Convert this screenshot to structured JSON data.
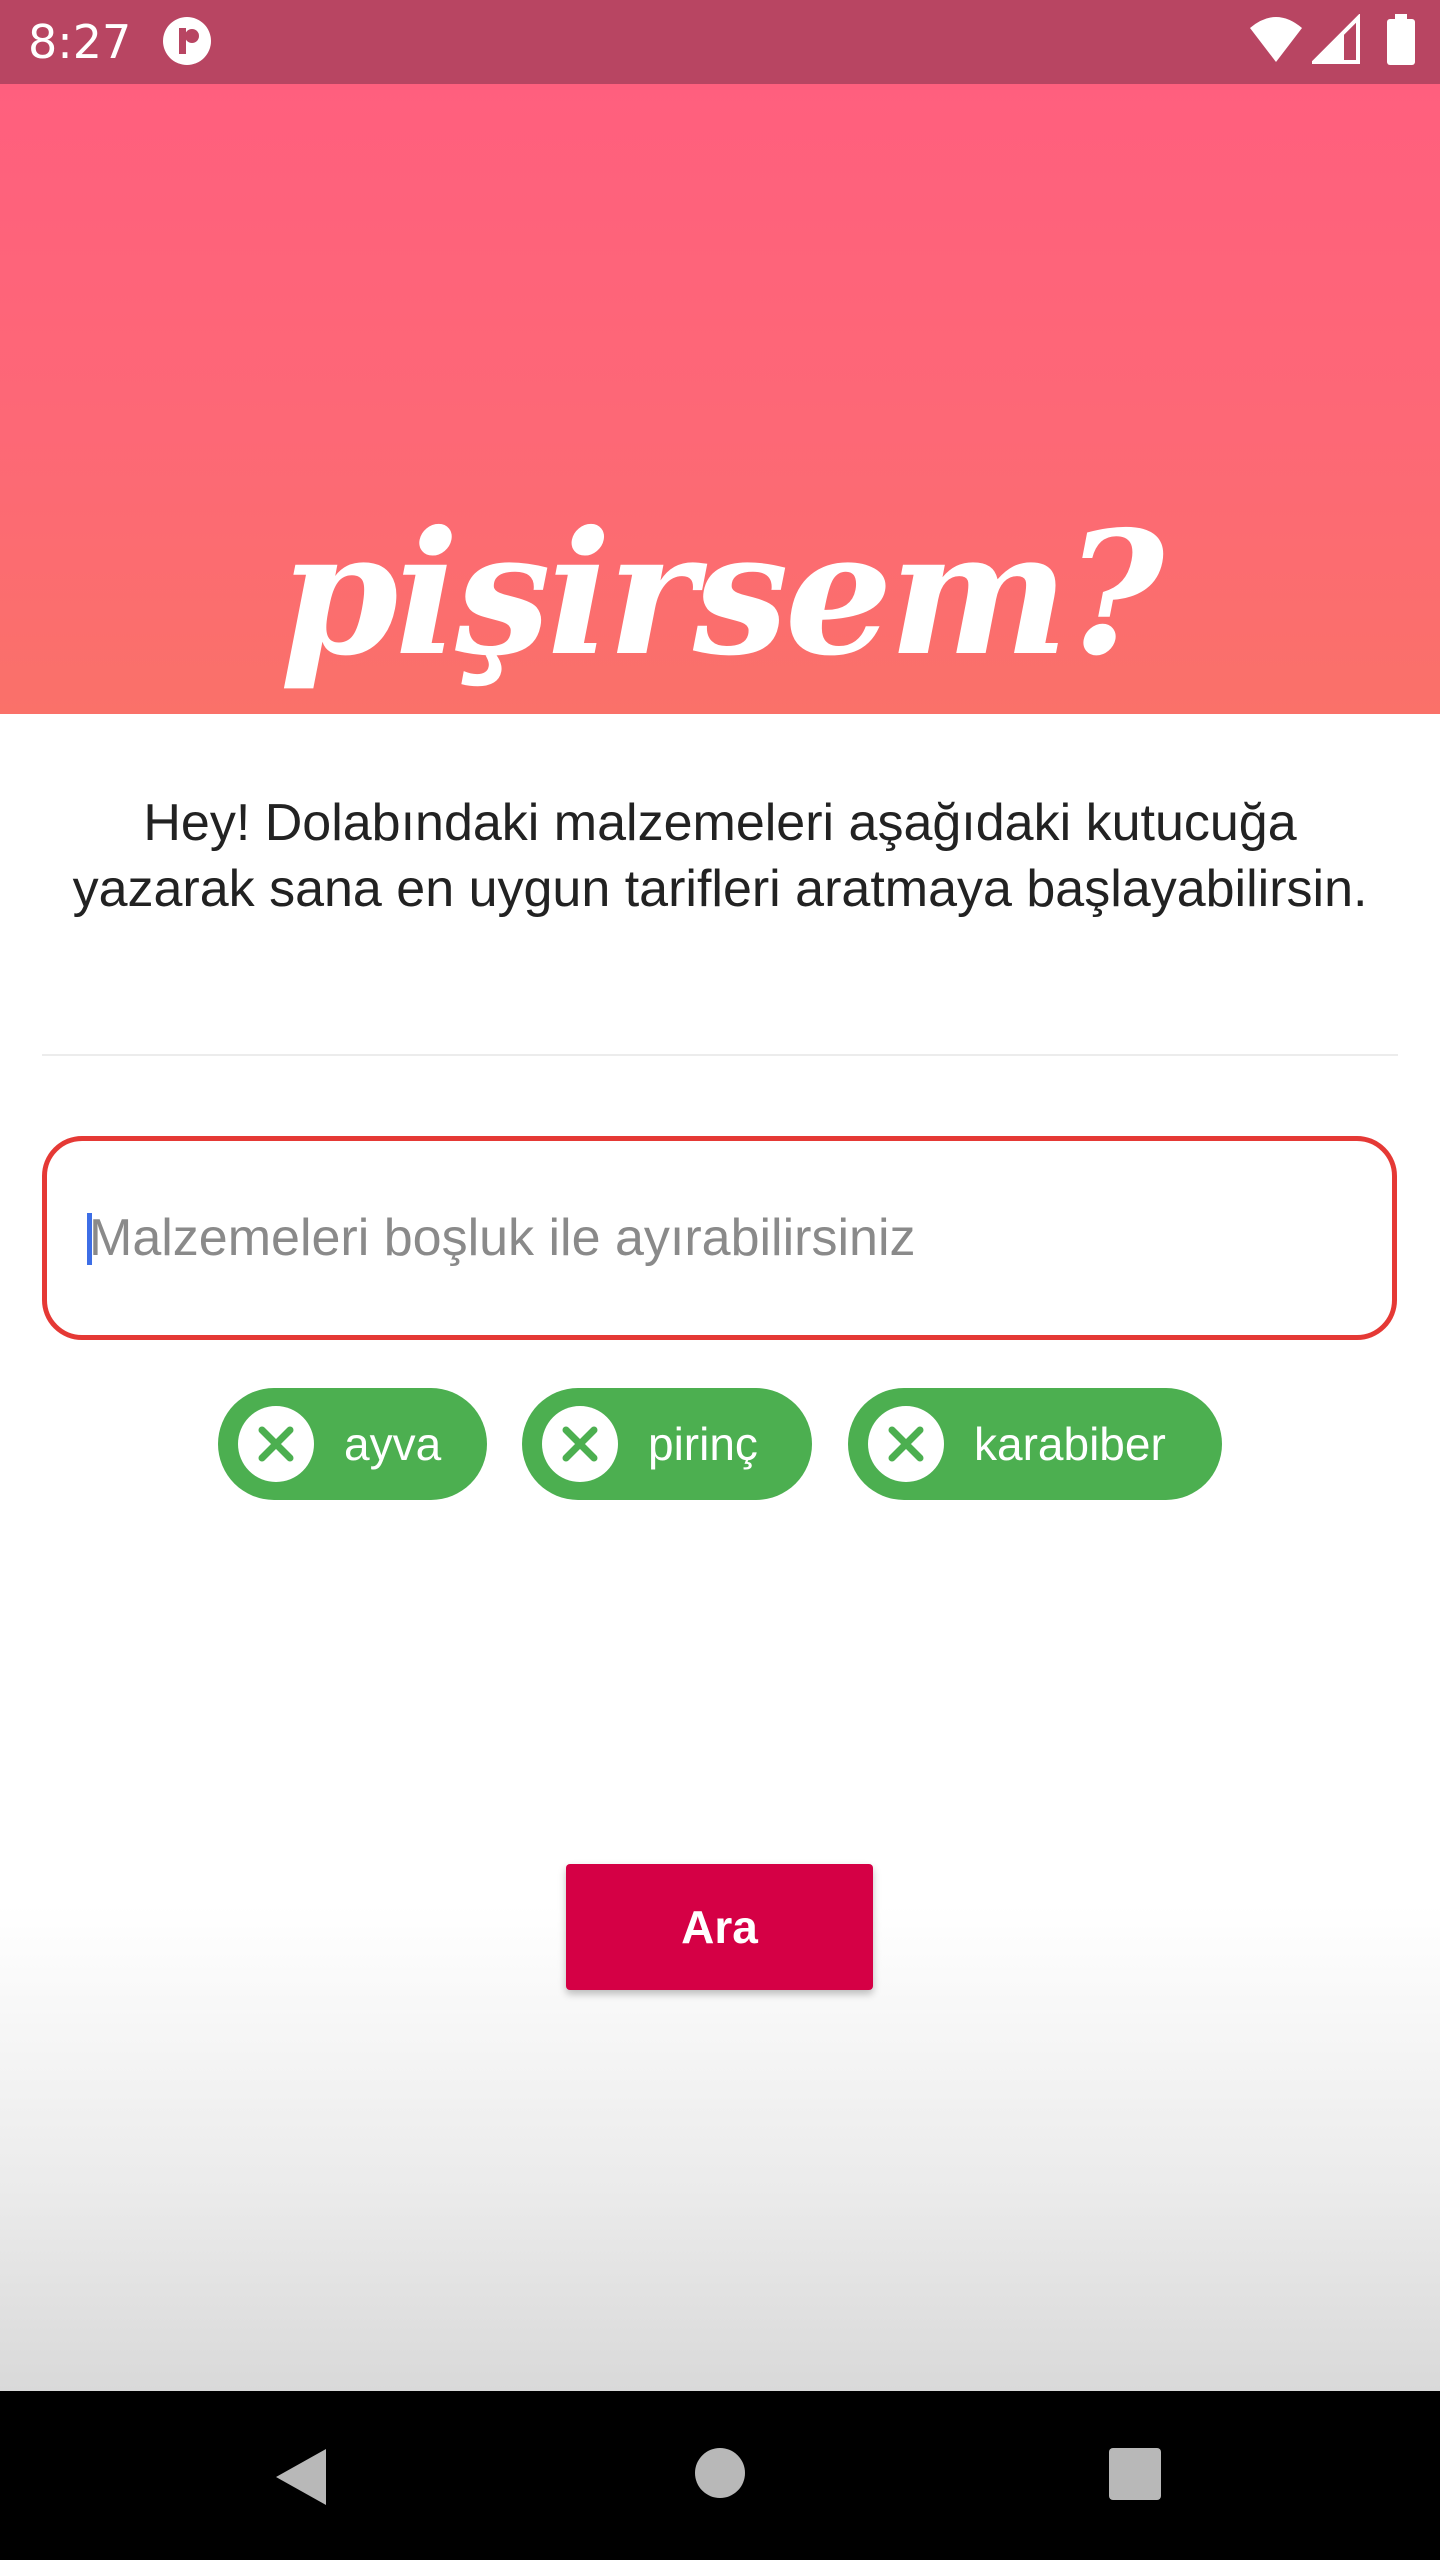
{
  "status_bar": {
    "time": "8:27",
    "icons": [
      "app-badge-icon",
      "wifi-icon",
      "signal-icon",
      "battery-icon"
    ]
  },
  "header": {
    "title": "pişirsem?"
  },
  "intro": {
    "text": "Hey! Dolabındaki malzemeleri aşağıdaki kutucuğa yazarak sana en uygun tarifleri aratmaya başlayabilirsin."
  },
  "search": {
    "placeholder": "Malzemeleri boşluk ile ayırabilirsiniz",
    "value": ""
  },
  "chips": [
    {
      "label": "ayva",
      "icon": "close-icon"
    },
    {
      "label": "pirinç",
      "icon": "close-icon"
    },
    {
      "label": "karabiber",
      "icon": "close-icon"
    }
  ],
  "action": {
    "search_label": "Ara"
  },
  "nav": {
    "icons": [
      "back-icon",
      "home-icon",
      "recents-icon"
    ]
  },
  "colors": {
    "status_bar": "#b84562",
    "header_top": "#ff5f7e",
    "header_bottom": "#fa7169",
    "input_border": "#e53935",
    "chip": "#4caf50",
    "button": "#d50045",
    "nav_bar": "#000000"
  }
}
